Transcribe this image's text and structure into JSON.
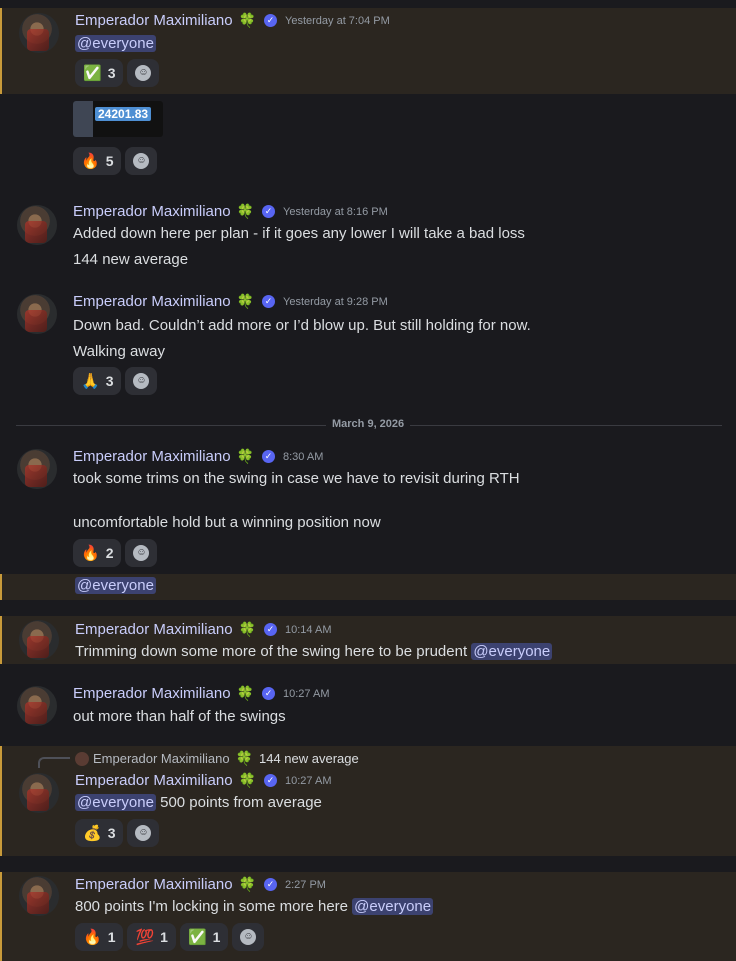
{
  "author": "Emperador Maximiliano",
  "emojis": {
    "clover": "🍀",
    "verified": "✓"
  },
  "messages": [
    {
      "time": "Yesterday at 7:04 PM",
      "text": "@everyone",
      "reactions": [
        {
          "emoji": "✅",
          "count": "3"
        }
      ]
    },
    {
      "embed_price": "24201.83",
      "reactions": [
        {
          "emoji": "🔥",
          "count": "5"
        }
      ]
    },
    {
      "time": "Yesterday at 8:16 PM",
      "line1": "Added down here per plan - if it goes any lower I will take a bad loss",
      "line2": "144 new average"
    },
    {
      "time": "Yesterday at 9:28 PM",
      "line1": "Down bad. Couldn’t add more or I’d blow up. But still holding for now.",
      "line2": "Walking away",
      "reactions": [
        {
          "emoji": "🙏",
          "count": "3"
        }
      ]
    },
    {
      "date_divider": "March 9, 2026"
    },
    {
      "time": "8:30 AM",
      "line1": "took some trims on the swing in case we have to revisit during RTH",
      "line2": "uncomfortable hold but a winning position now",
      "reactions": [
        {
          "emoji": "🔥",
          "count": "2"
        }
      ]
    },
    {
      "ping": "@everyone"
    },
    {
      "time": "10:14 AM",
      "text": "Trimming down some more of the swing here to be prudent",
      "ping": "@everyone"
    },
    {
      "time": "10:27 AM",
      "text": "out more than half of the swings"
    },
    {
      "reply_author": "Emperador Maximiliano",
      "reply_text": "144 new average",
      "time": "10:27 AM",
      "ping": "@everyone",
      "text": "500 points from average",
      "reactions": [
        {
          "emoji": "💰",
          "count": "3"
        }
      ]
    },
    {
      "time": "2:27 PM",
      "text": "800 points I'm locking in some more here",
      "ping": "@everyone",
      "reactions": [
        {
          "emoji": "🔥",
          "count": "1"
        },
        {
          "emoji": "💯",
          "count": "1"
        },
        {
          "emoji": "✅",
          "count": "1"
        }
      ]
    }
  ]
}
